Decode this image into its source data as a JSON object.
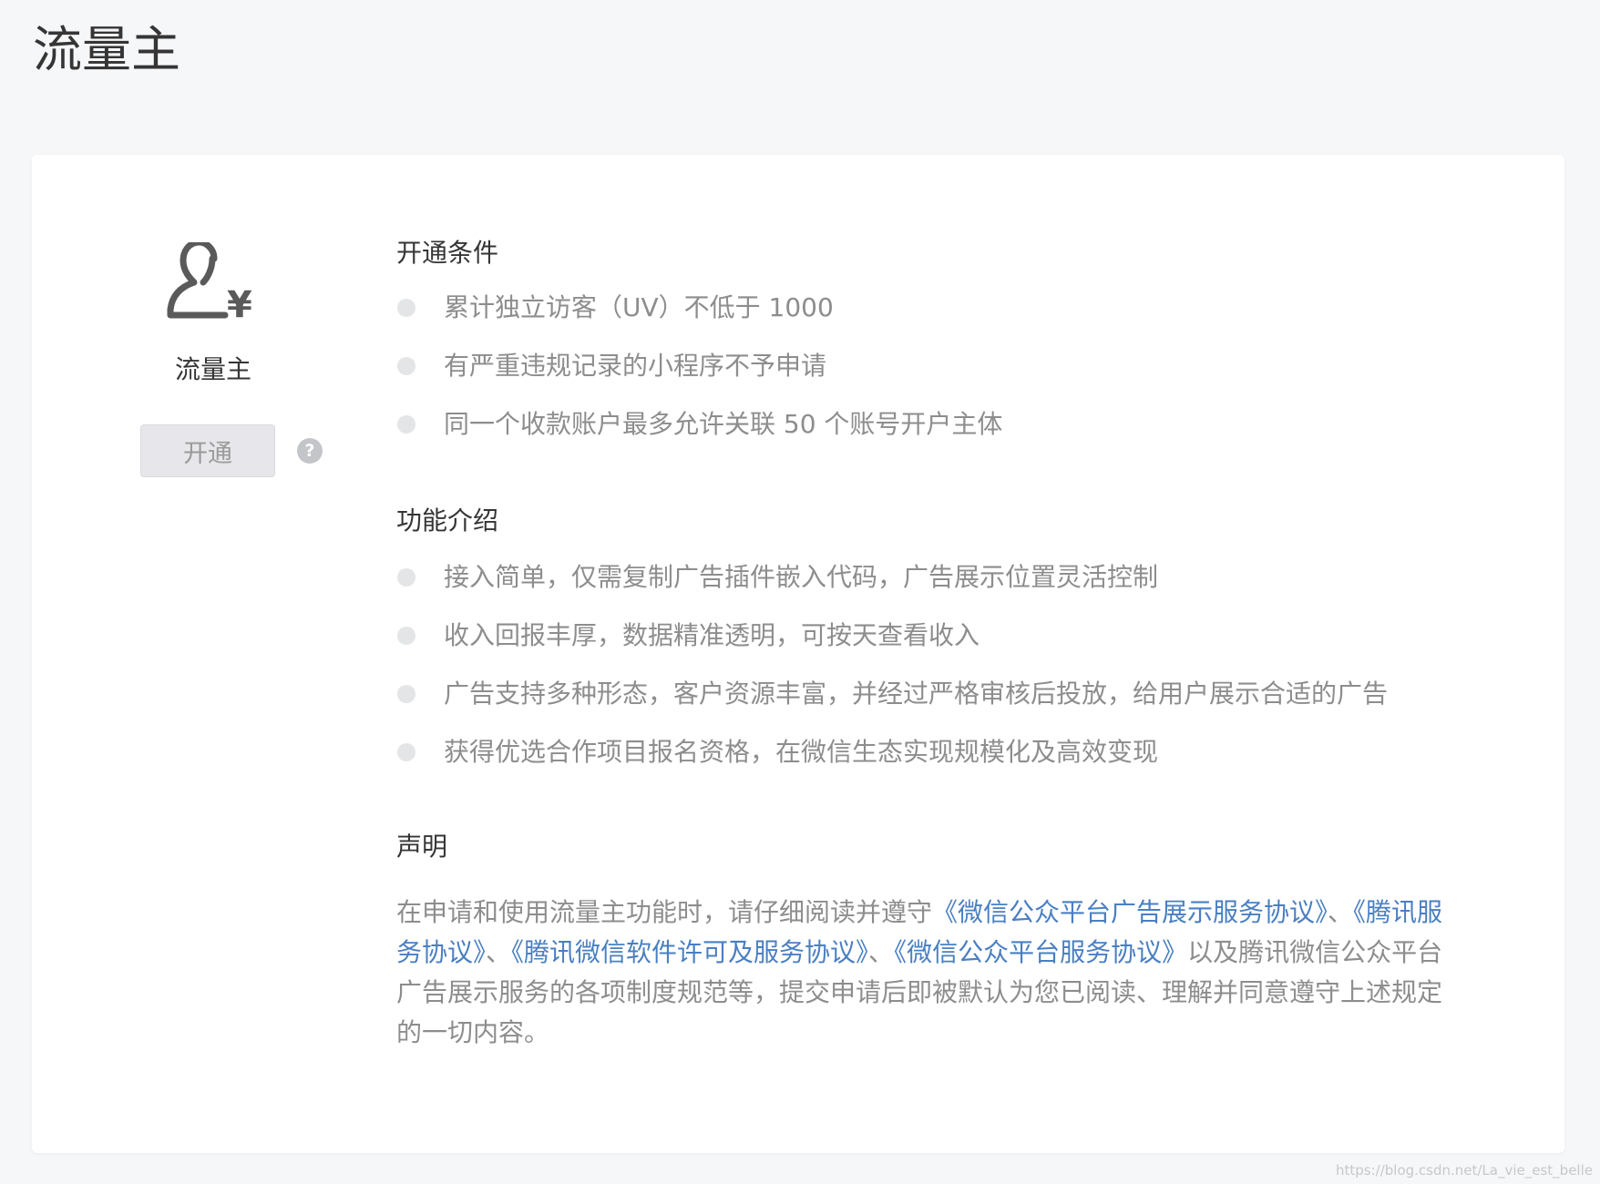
{
  "page": {
    "title": "流量主"
  },
  "service": {
    "icon": "user-yuan-icon",
    "name": "流量主",
    "open_button_label": "开通",
    "help_icon_glyph": "?"
  },
  "conditions": {
    "title": "开通条件",
    "items": [
      "累计独立访客（UV）不低于 1000",
      "有严重违规记录的小程序不予申请",
      "同一个收款账户最多允许关联 50 个账号开户主体"
    ]
  },
  "features": {
    "title": "功能介绍",
    "items": [
      "接入简单，仅需复制广告插件嵌入代码，广告展示位置灵活控制",
      "收入回报丰厚，数据精准透明，可按天查看收入",
      "广告支持多种形态，客户资源丰富，并经过严格审核后投放，给用户展示合适的广告",
      "获得优选合作项目报名资格，在微信生态实现规模化及高效变现"
    ]
  },
  "statement": {
    "title": "声明",
    "text_before": "在申请和使用流量主功能时，请仔细阅读并遵守",
    "link_1": "《微信公众平台广告展示服务协议》",
    "sep_1": "、",
    "link_2": "《腾讯服务协议》",
    "sep_2": "、",
    "link_3": "《腾讯微信软件许可及服务协议》",
    "sep_3": "、",
    "link_4": "《微信公众平台服务协议》",
    "text_after": "以及腾讯微信公众平台广告展示服务的各项制度规范等，提交申请后即被默认为您已阅读、理解并同意遵守上述规定的一切内容。"
  },
  "watermark": "https://blog.csdn.net/La_vie_est_belle",
  "colors": {
    "background": "#f6f7f9",
    "card": "#ffffff",
    "link": "#4a7fc1",
    "muted_text": "#8d8d8d",
    "disabled_button": "#e7e7eb"
  }
}
